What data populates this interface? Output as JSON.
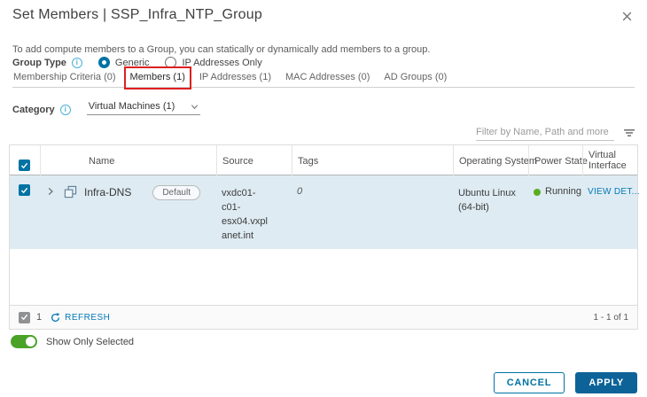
{
  "dialog": {
    "title": "Set Members | SSP_Infra_NTP_Group",
    "description": "To add compute members to a Group, you can statically or dynamically add members to a group."
  },
  "group_type": {
    "label": "Group Type",
    "options": [
      {
        "label": "Generic",
        "selected": true
      },
      {
        "label": "IP Addresses Only",
        "selected": false
      }
    ]
  },
  "tabs": [
    {
      "label": "Membership Criteria (0)",
      "active": false
    },
    {
      "label": "Members (1)",
      "active": true,
      "annotated": true
    },
    {
      "label": "IP Addresses (1)",
      "active": false
    },
    {
      "label": "MAC Addresses (0)",
      "active": false
    },
    {
      "label": "AD Groups (0)",
      "active": false
    }
  ],
  "category": {
    "label": "Category",
    "value": "Virtual Machines (1)"
  },
  "filter": {
    "placeholder": "Filter by Name, Path and more"
  },
  "table": {
    "columns": {
      "name": "Name",
      "source": "Source",
      "tags": "Tags",
      "os": "Operating System",
      "power": "Power State",
      "virtual_interface": "Virtual Interface"
    },
    "rows": [
      {
        "name": "Infra-DNS",
        "badge": "Default",
        "source": "vxdc01-c01-esx04.vxplanet.int",
        "source_lines": [
          "vxdc01-",
          "c01-",
          "esx04.vxpl",
          "anet.int"
        ],
        "tags": "0",
        "os": "Ubuntu Linux (64-bit)",
        "power_state": "Running",
        "action": "VIEW DET...",
        "selected": true
      }
    ],
    "footer": {
      "selected_count": "1",
      "refresh_label": "REFRESH",
      "pagination": "1 - 1 of 1"
    }
  },
  "toggle": {
    "label": "Show Only Selected",
    "on": true
  },
  "actions": {
    "cancel_label": "CANCEL",
    "apply_label": "APPLY"
  },
  "colors": {
    "accent_blue": "#0072a3",
    "apply_button": "#0d6398",
    "link_blue": "#0079b8",
    "selected_row": "#deebf2",
    "running_green": "#5aad20",
    "toggle_green": "#4aa327",
    "annotation_red": "#de2020"
  }
}
